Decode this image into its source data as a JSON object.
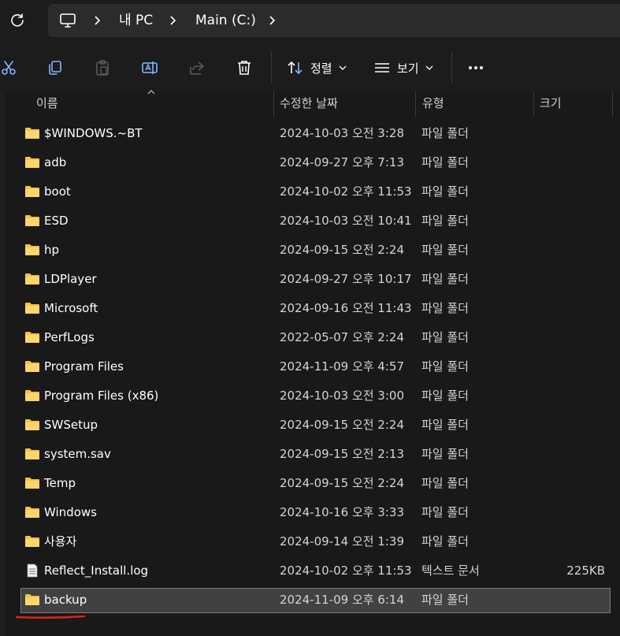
{
  "address": {
    "crumbs": [
      "내 PC",
      "Main (C:)"
    ]
  },
  "toolbar": {
    "sort_label": "정렬",
    "view_label": "보기",
    "icons": [
      "cut-icon",
      "copy-icon",
      "paste-icon",
      "rename-icon",
      "share-icon",
      "delete-icon",
      "sort-icon",
      "view-icon",
      "more-icon"
    ]
  },
  "columns": {
    "name": "이름",
    "date": "수정한 날짜",
    "type": "유형",
    "size": "크기"
  },
  "files": [
    {
      "name": "$WINDOWS.~BT",
      "date": "2024-10-03 오전 3:28",
      "type": "파일 폴더",
      "size": "",
      "icon": "folder"
    },
    {
      "name": "adb",
      "date": "2024-09-27 오후 7:13",
      "type": "파일 폴더",
      "size": "",
      "icon": "folder"
    },
    {
      "name": "boot",
      "date": "2024-10-02 오후 11:53",
      "type": "파일 폴더",
      "size": "",
      "icon": "folder"
    },
    {
      "name": "ESD",
      "date": "2024-10-03 오전 10:41",
      "type": "파일 폴더",
      "size": "",
      "icon": "folder"
    },
    {
      "name": "hp",
      "date": "2024-09-15 오전 2:24",
      "type": "파일 폴더",
      "size": "",
      "icon": "folder"
    },
    {
      "name": "LDPlayer",
      "date": "2024-09-27 오후 10:17",
      "type": "파일 폴더",
      "size": "",
      "icon": "folder"
    },
    {
      "name": "Microsoft",
      "date": "2024-09-16 오전 11:43",
      "type": "파일 폴더",
      "size": "",
      "icon": "folder"
    },
    {
      "name": "PerfLogs",
      "date": "2022-05-07 오후 2:24",
      "type": "파일 폴더",
      "size": "",
      "icon": "folder"
    },
    {
      "name": "Program Files",
      "date": "2024-11-09 오후 4:57",
      "type": "파일 폴더",
      "size": "",
      "icon": "folder"
    },
    {
      "name": "Program Files (x86)",
      "date": "2024-10-03 오전 3:00",
      "type": "파일 폴더",
      "size": "",
      "icon": "folder"
    },
    {
      "name": "SWSetup",
      "date": "2024-09-15 오전 2:24",
      "type": "파일 폴더",
      "size": "",
      "icon": "folder"
    },
    {
      "name": "system.sav",
      "date": "2024-09-15 오전 2:13",
      "type": "파일 폴더",
      "size": "",
      "icon": "folder"
    },
    {
      "name": "Temp",
      "date": "2024-09-15 오전 2:24",
      "type": "파일 폴더",
      "size": "",
      "icon": "folder"
    },
    {
      "name": "Windows",
      "date": "2024-10-16 오후 3:33",
      "type": "파일 폴더",
      "size": "",
      "icon": "folder"
    },
    {
      "name": "사용자",
      "date": "2024-09-14 오전 1:39",
      "type": "파일 폴더",
      "size": "",
      "icon": "folder"
    },
    {
      "name": "Reflect_Install.log",
      "date": "2024-10-02 오후 11:53",
      "type": "텍스트 문서",
      "size": "225KB",
      "icon": "text-file"
    },
    {
      "name": "backup",
      "date": "2024-11-09 오후 6:14",
      "type": "파일 폴더",
      "size": "",
      "icon": "folder",
      "selected": true
    }
  ],
  "colors": {
    "background": "#191919",
    "folder": "#f5c342",
    "selection": "#414141",
    "annotation_underline": "#e02020"
  }
}
